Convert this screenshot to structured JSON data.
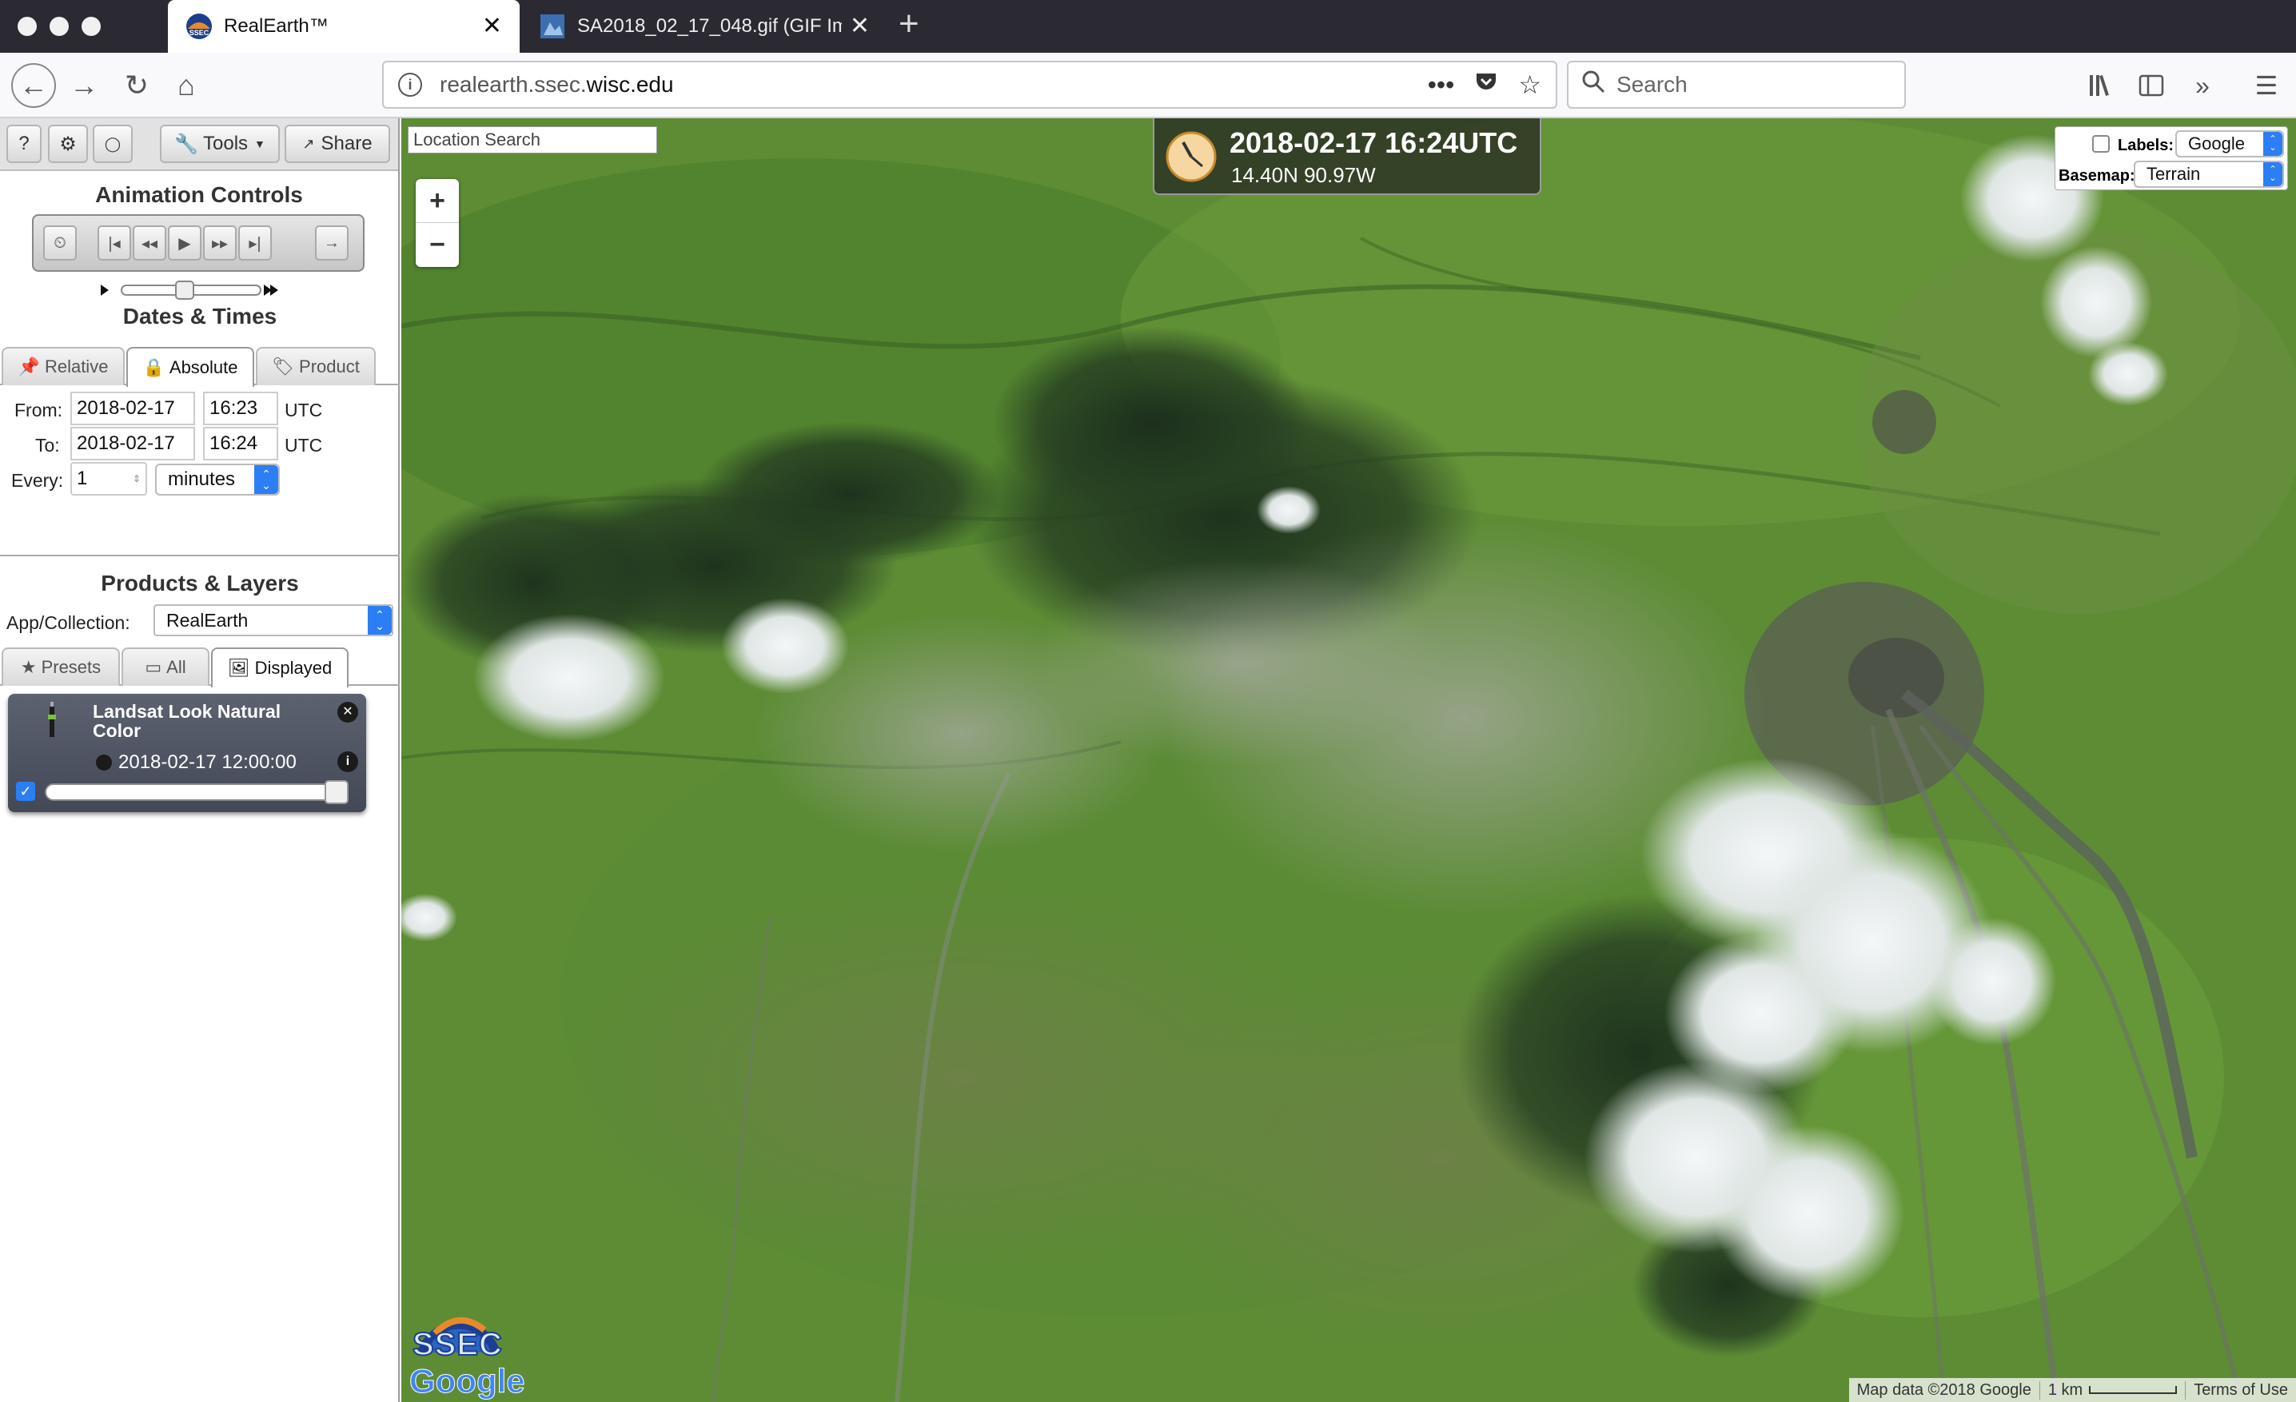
{
  "browser": {
    "tabs": [
      {
        "title": "RealEarth™",
        "icon": "ssec-favicon",
        "active": true
      },
      {
        "title": "SA2018_02_17_048.gif (GIF Imag",
        "icon": "image-favicon",
        "active": false
      }
    ],
    "new_tab_label": "+",
    "url_prefix": "realearth.ssec.",
    "url_domain": "wisc.edu",
    "search_placeholder": "Search",
    "page_actions_label": "•••"
  },
  "toolbar": {
    "help_label": "?",
    "settings_label": "⚙",
    "user_label": "👤",
    "tools_label": "Tools",
    "share_label": "Share"
  },
  "animation": {
    "heading": "Animation Controls",
    "buttons": [
      "⏲",
      "|◂",
      "◂◂",
      "▶",
      "▸▸",
      "▸|",
      "→"
    ]
  },
  "dates": {
    "heading": "Dates & Times",
    "tabs": [
      {
        "label": "Relative",
        "icon": "pin-icon",
        "selected": false
      },
      {
        "label": "Absolute",
        "icon": "lock-icon",
        "selected": true
      },
      {
        "label": "Product",
        "icon": "tag-icon",
        "selected": false
      }
    ],
    "from_label": "From:",
    "to_label": "To:",
    "every_label": "Every:",
    "from_date": "2018-02-17",
    "from_time": "16:23",
    "to_date": "2018-02-17",
    "to_time": "16:24",
    "tz": "UTC",
    "every_value": "1",
    "every_unit": "minutes"
  },
  "products": {
    "heading": "Products & Layers",
    "collection_label": "App/Collection:",
    "collection_value": "RealEarth",
    "tabs": [
      {
        "label": "Presets",
        "icon": "star-icon",
        "selected": false
      },
      {
        "label": "All",
        "icon": "folder-icon",
        "selected": false
      },
      {
        "label": "Displayed",
        "icon": "image-icon",
        "selected": true
      }
    ],
    "layer": {
      "name": "Landsat Look Natural Color",
      "timestamp": "2018-02-17 12:00:00",
      "visible": true,
      "opacity": 1.0
    }
  },
  "map": {
    "location_search_placeholder": "Location Search",
    "zoom_in": "+",
    "zoom_out": "−",
    "datetime": "2018-02-17 16:24UTC",
    "coords": "14.40N 90.97W",
    "labels_label": "Labels:",
    "labels_value": "Google",
    "labels_checked": false,
    "basemap_label": "Basemap:",
    "basemap_value": "Terrain",
    "logo_text": "SSEC",
    "google_text": "Google",
    "attribution": "Map data ©2018 Google",
    "scale_label": "1 km",
    "terms": "Terms of Use"
  },
  "colors": {
    "accent_blue": "#2c7ef5",
    "map_green": "#5f8a36",
    "tabbar": "#2b2a33"
  }
}
